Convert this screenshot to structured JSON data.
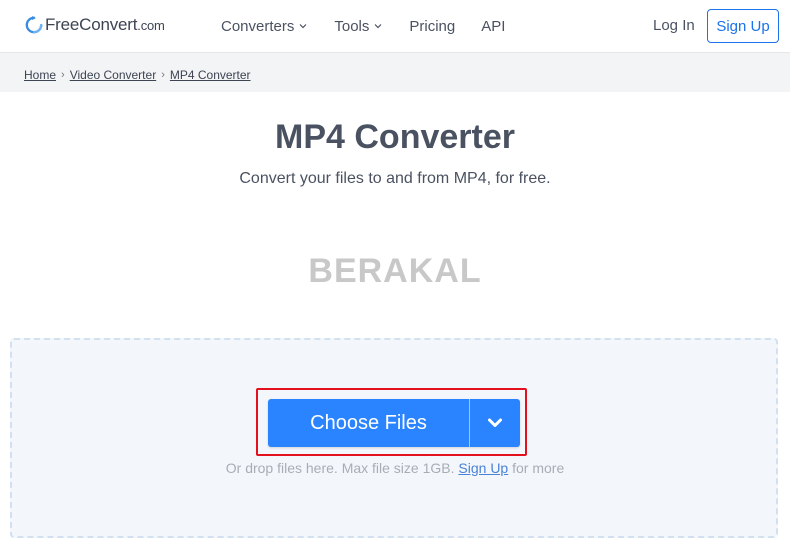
{
  "header": {
    "logo": {
      "name": "FreeConvert",
      "suffix": ".com"
    },
    "nav": [
      {
        "label": "Converters",
        "has_dropdown": true
      },
      {
        "label": "Tools",
        "has_dropdown": true
      },
      {
        "label": "Pricing",
        "has_dropdown": false
      },
      {
        "label": "API",
        "has_dropdown": false
      }
    ],
    "login_label": "Log In",
    "signup_label": "Sign Up"
  },
  "breadcrumb": {
    "items": [
      "Home",
      "Video Converter",
      "MP4 Converter"
    ],
    "separator": "›"
  },
  "main": {
    "title": "MP4 Converter",
    "subtitle": "Convert your files to and from MP4, for free.",
    "watermark": "BERAKAL"
  },
  "upload": {
    "button_label": "Choose Files",
    "dropdown_icon": "chevron-down-icon",
    "hint_before": "Or drop files here. Max file size 1GB.",
    "hint_link": "Sign Up",
    "hint_after": "for more"
  },
  "colors": {
    "accent": "#2b84ff",
    "signup_border": "#1a73e8",
    "highlight": "#e3101e",
    "dropzone_bg": "#f3f7fc",
    "text": "#4a5261",
    "watermark": "#c8c8c8"
  }
}
